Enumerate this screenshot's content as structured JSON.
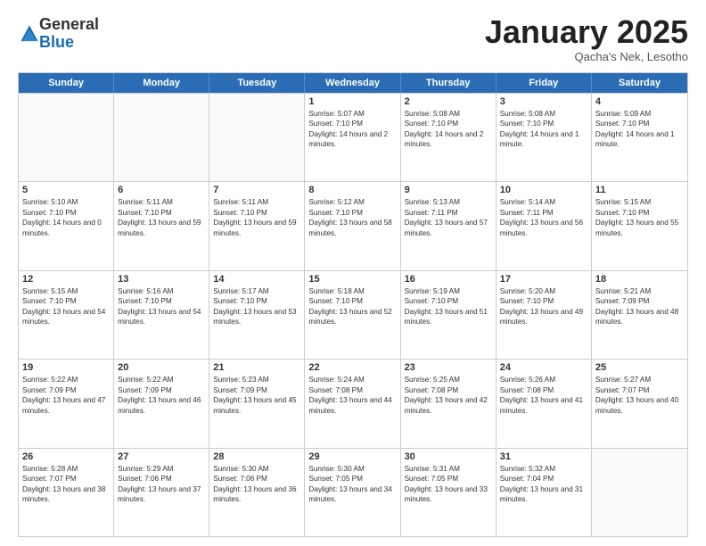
{
  "logo": {
    "general": "General",
    "blue": "Blue"
  },
  "header": {
    "month": "January 2025",
    "location": "Qacha's Nek, Lesotho"
  },
  "weekdays": [
    "Sunday",
    "Monday",
    "Tuesday",
    "Wednesday",
    "Thursday",
    "Friday",
    "Saturday"
  ],
  "rows": [
    [
      {
        "day": "",
        "info": ""
      },
      {
        "day": "",
        "info": ""
      },
      {
        "day": "",
        "info": ""
      },
      {
        "day": "1",
        "info": "Sunrise: 5:07 AM\nSunset: 7:10 PM\nDaylight: 14 hours and 2 minutes."
      },
      {
        "day": "2",
        "info": "Sunrise: 5:08 AM\nSunset: 7:10 PM\nDaylight: 14 hours and 2 minutes."
      },
      {
        "day": "3",
        "info": "Sunrise: 5:08 AM\nSunset: 7:10 PM\nDaylight: 14 hours and 1 minute."
      },
      {
        "day": "4",
        "info": "Sunrise: 5:09 AM\nSunset: 7:10 PM\nDaylight: 14 hours and 1 minute."
      }
    ],
    [
      {
        "day": "5",
        "info": "Sunrise: 5:10 AM\nSunset: 7:10 PM\nDaylight: 14 hours and 0 minutes."
      },
      {
        "day": "6",
        "info": "Sunrise: 5:11 AM\nSunset: 7:10 PM\nDaylight: 13 hours and 59 minutes."
      },
      {
        "day": "7",
        "info": "Sunrise: 5:11 AM\nSunset: 7:10 PM\nDaylight: 13 hours and 59 minutes."
      },
      {
        "day": "8",
        "info": "Sunrise: 5:12 AM\nSunset: 7:10 PM\nDaylight: 13 hours and 58 minutes."
      },
      {
        "day": "9",
        "info": "Sunrise: 5:13 AM\nSunset: 7:11 PM\nDaylight: 13 hours and 57 minutes."
      },
      {
        "day": "10",
        "info": "Sunrise: 5:14 AM\nSunset: 7:11 PM\nDaylight: 13 hours and 56 minutes."
      },
      {
        "day": "11",
        "info": "Sunrise: 5:15 AM\nSunset: 7:10 PM\nDaylight: 13 hours and 55 minutes."
      }
    ],
    [
      {
        "day": "12",
        "info": "Sunrise: 5:15 AM\nSunset: 7:10 PM\nDaylight: 13 hours and 54 minutes."
      },
      {
        "day": "13",
        "info": "Sunrise: 5:16 AM\nSunset: 7:10 PM\nDaylight: 13 hours and 54 minutes."
      },
      {
        "day": "14",
        "info": "Sunrise: 5:17 AM\nSunset: 7:10 PM\nDaylight: 13 hours and 53 minutes."
      },
      {
        "day": "15",
        "info": "Sunrise: 5:18 AM\nSunset: 7:10 PM\nDaylight: 13 hours and 52 minutes."
      },
      {
        "day": "16",
        "info": "Sunrise: 5:19 AM\nSunset: 7:10 PM\nDaylight: 13 hours and 51 minutes."
      },
      {
        "day": "17",
        "info": "Sunrise: 5:20 AM\nSunset: 7:10 PM\nDaylight: 13 hours and 49 minutes."
      },
      {
        "day": "18",
        "info": "Sunrise: 5:21 AM\nSunset: 7:09 PM\nDaylight: 13 hours and 48 minutes."
      }
    ],
    [
      {
        "day": "19",
        "info": "Sunrise: 5:22 AM\nSunset: 7:09 PM\nDaylight: 13 hours and 47 minutes."
      },
      {
        "day": "20",
        "info": "Sunrise: 5:22 AM\nSunset: 7:09 PM\nDaylight: 13 hours and 46 minutes."
      },
      {
        "day": "21",
        "info": "Sunrise: 5:23 AM\nSunset: 7:09 PM\nDaylight: 13 hours and 45 minutes."
      },
      {
        "day": "22",
        "info": "Sunrise: 5:24 AM\nSunset: 7:08 PM\nDaylight: 13 hours and 44 minutes."
      },
      {
        "day": "23",
        "info": "Sunrise: 5:25 AM\nSunset: 7:08 PM\nDaylight: 13 hours and 42 minutes."
      },
      {
        "day": "24",
        "info": "Sunrise: 5:26 AM\nSunset: 7:08 PM\nDaylight: 13 hours and 41 minutes."
      },
      {
        "day": "25",
        "info": "Sunrise: 5:27 AM\nSunset: 7:07 PM\nDaylight: 13 hours and 40 minutes."
      }
    ],
    [
      {
        "day": "26",
        "info": "Sunrise: 5:28 AM\nSunset: 7:07 PM\nDaylight: 13 hours and 38 minutes."
      },
      {
        "day": "27",
        "info": "Sunrise: 5:29 AM\nSunset: 7:06 PM\nDaylight: 13 hours and 37 minutes."
      },
      {
        "day": "28",
        "info": "Sunrise: 5:30 AM\nSunset: 7:06 PM\nDaylight: 13 hours and 36 minutes."
      },
      {
        "day": "29",
        "info": "Sunrise: 5:30 AM\nSunset: 7:05 PM\nDaylight: 13 hours and 34 minutes."
      },
      {
        "day": "30",
        "info": "Sunrise: 5:31 AM\nSunset: 7:05 PM\nDaylight: 13 hours and 33 minutes."
      },
      {
        "day": "31",
        "info": "Sunrise: 5:32 AM\nSunset: 7:04 PM\nDaylight: 13 hours and 31 minutes."
      },
      {
        "day": "",
        "info": ""
      }
    ]
  ]
}
